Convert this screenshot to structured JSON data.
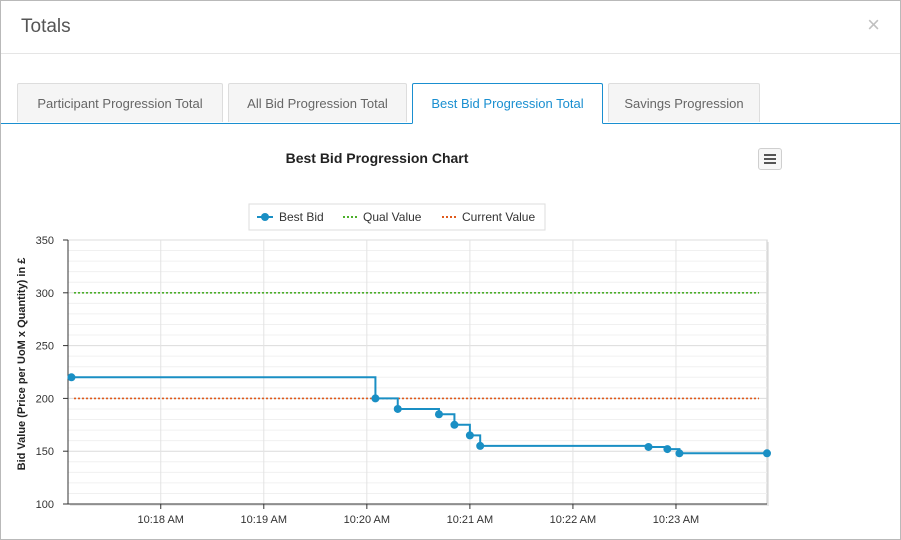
{
  "modal": {
    "title": "Totals",
    "close_glyph": "×"
  },
  "tabs": [
    {
      "label": "Participant Progression Total",
      "active": false
    },
    {
      "label": "All Bid Progression Total",
      "active": false
    },
    {
      "label": "Best Bid Progression Total",
      "active": true
    },
    {
      "label": "Savings Progression",
      "active": false
    }
  ],
  "colors": {
    "accent": "#1a8fd0",
    "best_bid": "#1a8fc4",
    "qual_value": "#4caf2a",
    "current_value": "#e05a1c"
  },
  "icons": {
    "chart_menu": "hamburger-menu-icon",
    "close": "close-icon"
  },
  "chart_data": {
    "type": "line",
    "title": "Best Bid Progression Chart",
    "xlabel": "",
    "ylabel": "Bid Value (Price per UoM x Quantity) in £",
    "ylim": [
      100,
      350
    ],
    "yticks": [
      100,
      150,
      200,
      250,
      300,
      350
    ],
    "xlim": [
      "10:17:06",
      "10:23:53"
    ],
    "xticks": [
      "10:18 AM",
      "10:19 AM",
      "10:20 AM",
      "10:21 AM",
      "10:22 AM",
      "10:23 AM"
    ],
    "grid": true,
    "legend_position": "top-center",
    "series": [
      {
        "name": "Best Bid",
        "style": "step",
        "points": [
          {
            "x": "10:17:08",
            "y": 220
          },
          {
            "x": "10:20:05",
            "y": 200
          },
          {
            "x": "10:20:18",
            "y": 190
          },
          {
            "x": "10:20:42",
            "y": 185
          },
          {
            "x": "10:20:51",
            "y": 175
          },
          {
            "x": "10:21:00",
            "y": 165
          },
          {
            "x": "10:21:06",
            "y": 155
          },
          {
            "x": "10:22:44",
            "y": 154
          },
          {
            "x": "10:22:55",
            "y": 152
          },
          {
            "x": "10:23:02",
            "y": 148
          },
          {
            "x": "10:23:53",
            "y": 148
          }
        ]
      },
      {
        "name": "Qual Value",
        "style": "dotted",
        "value": 300
      },
      {
        "name": "Current Value",
        "style": "dotted",
        "value": 200
      }
    ]
  }
}
